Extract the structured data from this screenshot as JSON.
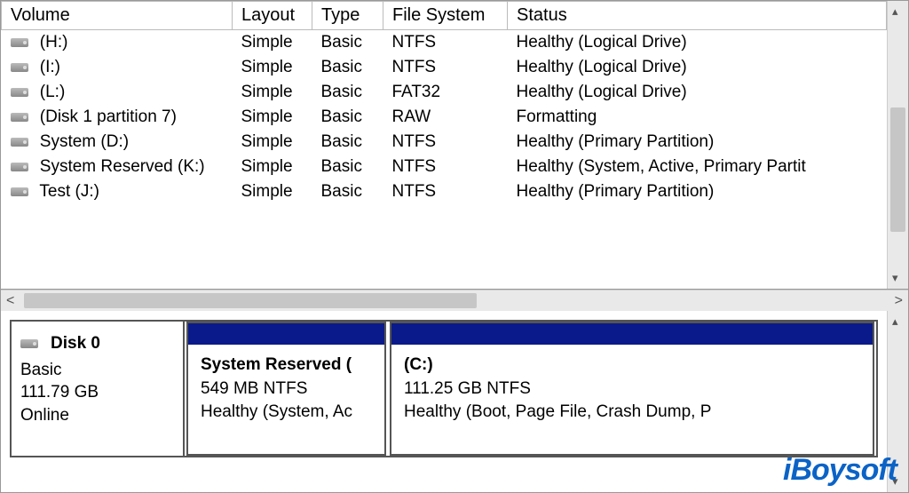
{
  "columns": {
    "volume": "Volume",
    "layout": "Layout",
    "type": "Type",
    "filesystem": "File System",
    "status": "Status"
  },
  "volumes": [
    {
      "name": " (H:)",
      "layout": "Simple",
      "type": "Basic",
      "fs": "NTFS",
      "status": "Healthy (Logical Drive)"
    },
    {
      "name": " (I:)",
      "layout": "Simple",
      "type": "Basic",
      "fs": "NTFS",
      "status": "Healthy (Logical Drive)"
    },
    {
      "name": " (L:)",
      "layout": "Simple",
      "type": "Basic",
      "fs": "FAT32",
      "status": "Healthy (Logical Drive)"
    },
    {
      "name": " (Disk 1 partition 7)",
      "layout": "Simple",
      "type": "Basic",
      "fs": "RAW",
      "status": "Formatting"
    },
    {
      "name": " System (D:)",
      "layout": "Simple",
      "type": "Basic",
      "fs": "NTFS",
      "status": "Healthy (Primary Partition)"
    },
    {
      "name": " System Reserved (K:)",
      "layout": "Simple",
      "type": "Basic",
      "fs": "NTFS",
      "status": "Healthy (System, Active, Primary Partit"
    },
    {
      "name": " Test (J:)",
      "layout": "Simple",
      "type": "Basic",
      "fs": "NTFS",
      "status": "Healthy (Primary Partition)"
    }
  ],
  "disk": {
    "name": "Disk 0",
    "type": "Basic",
    "size": "111.79 GB",
    "state": "Online",
    "partitions": [
      {
        "title": "System Reserved  (",
        "sizefs": "549 MB NTFS",
        "status": "Healthy (System, Ac"
      },
      {
        "title": "(C:)",
        "sizefs": "111.25 GB NTFS",
        "status": "Healthy (Boot, Page File, Crash Dump, P"
      }
    ]
  },
  "watermark": "iBoysoft"
}
